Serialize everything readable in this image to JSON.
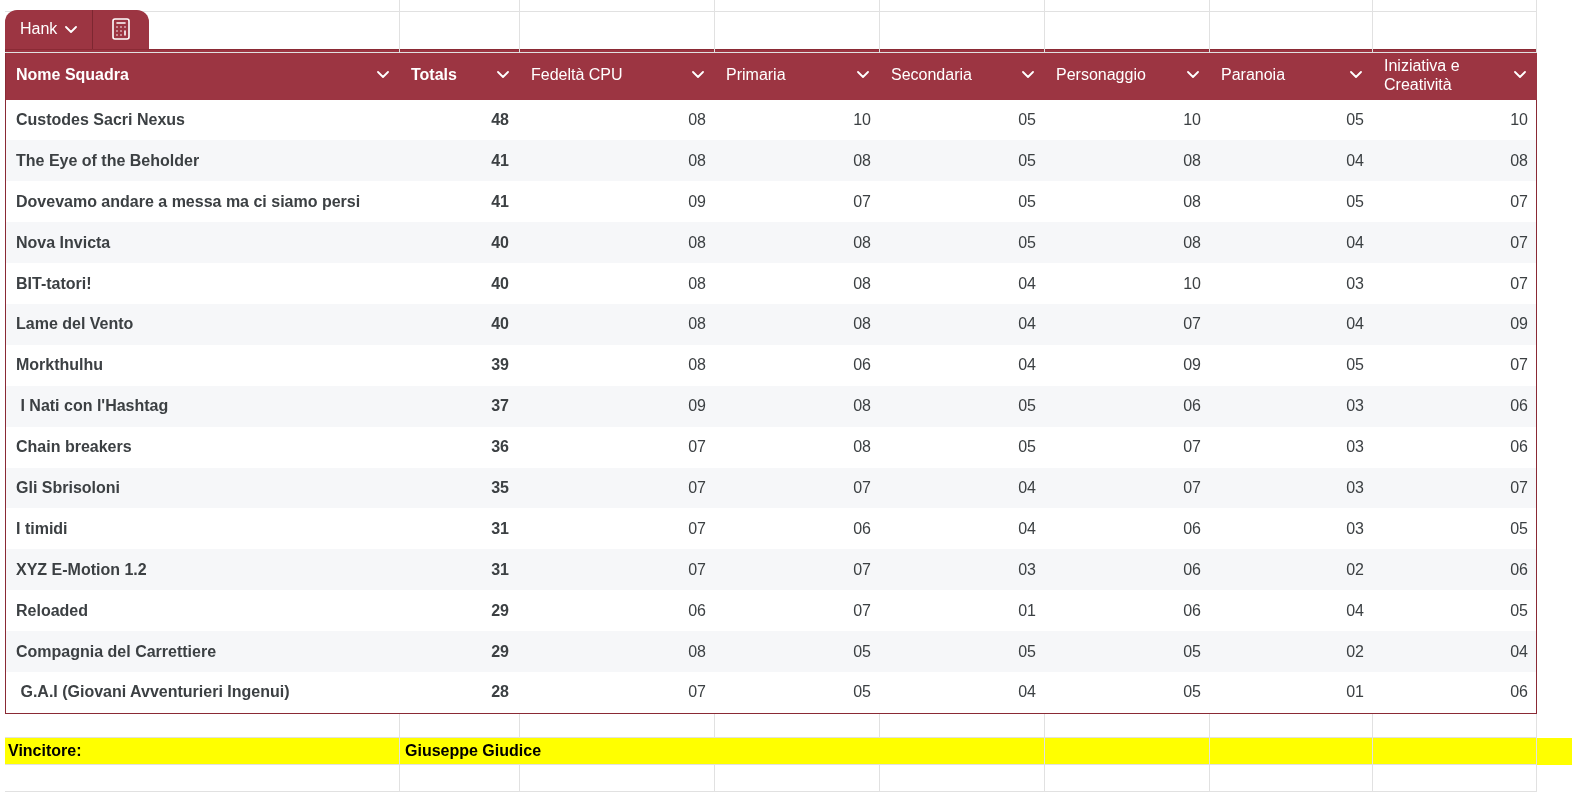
{
  "table_tab": {
    "label": "Hank"
  },
  "columns": [
    "Nome Squadra",
    "Totals",
    "Fedeltà CPU",
    "Primaria",
    "Secondaria",
    "Personaggio",
    "Paranoia",
    "Iniziativa e Creatività"
  ],
  "rows": [
    {
      "name": "Custodes Sacri Nexus",
      "total": "48",
      "scores": [
        "08",
        "10",
        "05",
        "10",
        "05",
        "10"
      ]
    },
    {
      "name": "The Eye of the Beholder",
      "total": "41",
      "scores": [
        "08",
        "08",
        "05",
        "08",
        "04",
        "08"
      ]
    },
    {
      "name": "Dovevamo andare a messa ma ci siamo persi",
      "total": "41",
      "scores": [
        "09",
        "07",
        "05",
        "08",
        "05",
        "07"
      ]
    },
    {
      "name": "Nova Invicta",
      "total": "40",
      "scores": [
        "08",
        "08",
        "05",
        "08",
        "04",
        "07"
      ]
    },
    {
      "name": "BIT-tatori!",
      "total": "40",
      "scores": [
        "08",
        "08",
        "04",
        "10",
        "03",
        "07"
      ]
    },
    {
      "name": "Lame del Vento",
      "total": "40",
      "scores": [
        "08",
        "08",
        "04",
        "07",
        "04",
        "09"
      ]
    },
    {
      "name": "Morkthulhu",
      "total": "39",
      "scores": [
        "08",
        "06",
        "04",
        "09",
        "05",
        "07"
      ]
    },
    {
      "name": " I Nati con l'Hashtag",
      "total": "37",
      "scores": [
        "09",
        "08",
        "05",
        "06",
        "03",
        "06"
      ]
    },
    {
      "name": "Chain breakers",
      "total": "36",
      "scores": [
        "07",
        "08",
        "05",
        "07",
        "03",
        "06"
      ]
    },
    {
      "name": "Gli Sbrisoloni",
      "total": "35",
      "scores": [
        "07",
        "07",
        "04",
        "07",
        "03",
        "07"
      ]
    },
    {
      "name": "I timidi",
      "total": "31",
      "scores": [
        "07",
        "06",
        "04",
        "06",
        "03",
        "05"
      ]
    },
    {
      "name": "XYZ E-Motion 1.2",
      "total": "31",
      "scores": [
        "07",
        "07",
        "03",
        "06",
        "02",
        "06"
      ]
    },
    {
      "name": "Reloaded",
      "total": "29",
      "scores": [
        "06",
        "07",
        "01",
        "06",
        "04",
        "05"
      ]
    },
    {
      "name": "Compagnia del Carrettiere",
      "total": "29",
      "scores": [
        "08",
        "05",
        "05",
        "05",
        "02",
        "04"
      ]
    },
    {
      "name": " G.A.I (Giovani Avventurieri Ingenui)",
      "total": "28",
      "scores": [
        "07",
        "05",
        "04",
        "05",
        "01",
        "06"
      ]
    }
  ],
  "winner": {
    "label": "Vincitore:",
    "value": "Giuseppe Giudice"
  }
}
